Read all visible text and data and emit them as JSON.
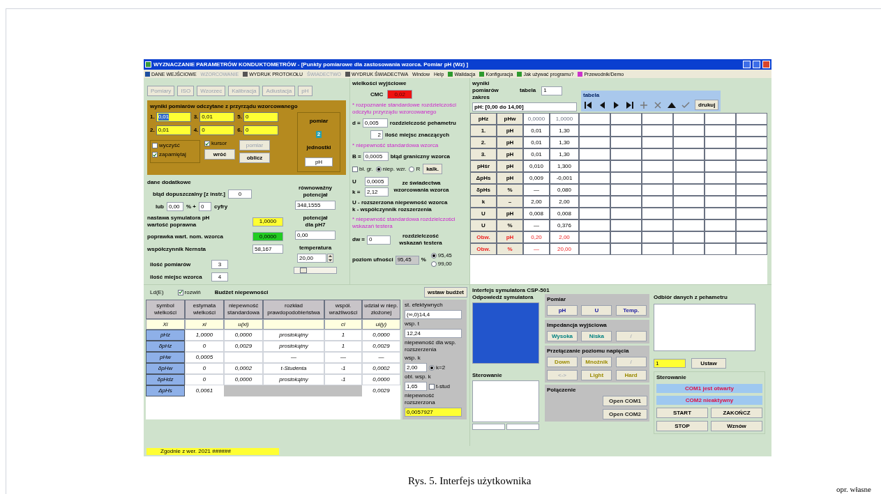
{
  "window": {
    "title": "WYZNACZANIE PARAMETRÓW KONDUKTOMETRÓW - [Punkty pomiarowe dla zastosowania wzorca. Pomiar pH (Wz) ]"
  },
  "menu": [
    {
      "label": "DANE WEJŚCIOWE",
      "disabled": false,
      "color": "#1f4fa0"
    },
    {
      "label": "WZORCOWANIE",
      "disabled": true
    },
    {
      "label": "WYDRUK PROTOKOŁU",
      "disabled": false,
      "color": "#555555"
    },
    {
      "label": "ŚWIADECTWO",
      "disabled": true
    },
    {
      "label": "WYDRUK ŚWIADECTWA",
      "disabled": false,
      "color": "#555555"
    },
    {
      "label": "Window",
      "disabled": false
    },
    {
      "label": "Help",
      "disabled": false
    },
    {
      "label": "Walidacja",
      "disabled": false,
      "color": "#2e9a2e"
    },
    {
      "label": "Konfiguracja",
      "disabled": false,
      "color": "#2e9a2e"
    },
    {
      "label": "Jak używać programu?",
      "disabled": false,
      "color": "#2e9a2e"
    },
    {
      "label": "Przewodnik/Demo",
      "disabled": false,
      "color": "#cc33cc"
    }
  ],
  "toolbar": [
    {
      "label": "Pomiary",
      "disabled": true
    },
    {
      "label": "ISO",
      "disabled": true
    },
    {
      "label": "Wzorzec",
      "disabled": true
    },
    {
      "label": "Kalibracja",
      "disabled": true
    },
    {
      "label": "Adiustacja",
      "disabled": true
    },
    {
      "label": "pH",
      "disabled": true
    }
  ],
  "readings": {
    "title": "wyniki pomiarów odczytane z przyrządu wzorcowanego",
    "fields": [
      {
        "index": "1.",
        "value": "0,01",
        "selected": true
      },
      {
        "index": "3.",
        "value": "0,01",
        "selected": false
      },
      {
        "index": "5.",
        "value": "0",
        "selected": false
      },
      {
        "index": "2.",
        "value": "0,01",
        "selected": false
      },
      {
        "index": "4.",
        "value": "0",
        "selected": false
      },
      {
        "index": "6.",
        "value": "0",
        "selected": false
      }
    ],
    "measure_label": "pomiar",
    "measure_value": "2",
    "unit_label": "jednostki",
    "unit": "pH",
    "checks": [
      {
        "label": "wyczyść",
        "checked": false
      },
      {
        "label": "zapamiętaj",
        "checked": true
      },
      {
        "label": "kursor",
        "checked": true
      }
    ],
    "buttons": [
      {
        "label": "pomiar",
        "disabled": true
      },
      {
        "label": "wróć",
        "disabled": false
      },
      {
        "label": "oblicz",
        "disabled": false
      }
    ]
  },
  "extra": {
    "title": "dane dodatkowe",
    "error_label": "błąd dopuszczalny [z instr.]",
    "error_value": "0",
    "or_label": "lub",
    "percent_value": "0,00",
    "percent_label": "% +",
    "digits_value": "0",
    "digits_label": "cyfry",
    "setpoint_label": "nastawa symulatora pH wartość poprawna",
    "setpoint_value": "1,0000",
    "correction_label": "poprawka wart. nom. wzorca",
    "correction_value": "0,0000",
    "nernst_label": "współczynnik Nernsta",
    "nernst_value": "58,167",
    "count_label": "ilość pomiarów",
    "count_value": "3",
    "places_label": "ilość miejsc wzorca",
    "places_value": "4",
    "potential_label": "równoważny potencjał",
    "potential_value": "348,1555",
    "ph7_label": "potencjał dla pH7",
    "ph7_value": "0,00",
    "temp_label": "temperatura",
    "temp_value": "20,00",
    "temp_slider": {
      "level": 0.15
    }
  },
  "outputs": {
    "title": "wielkości wyjściowe",
    "cmc_label": "CMC",
    "cmc_value": "0,02",
    "note1": "* rozpoznanie standardowe rozdzielczości odczytu przyrządu wzorcowanego",
    "d_label": "d =",
    "d_value": "0,005",
    "d_desc": "rozdzielczość pehametru",
    "digits_value": "2",
    "digits_desc": "ilość miejsc znaczących",
    "note2": "* niepewność standardowa wzorca",
    "b_label": "B =",
    "b_value": "0,0005",
    "b_desc": "błąd graniczny wzorca",
    "options": [
      {
        "kind": "checkbox",
        "label": "bł. gr.",
        "selected": false
      },
      {
        "kind": "radio",
        "label": "niep. wzr.",
        "selected": true
      },
      {
        "kind": "radio",
        "label": "R",
        "selected": false
      }
    ],
    "calc_button": "kalk.",
    "u_label": "U",
    "u_value": "0,0005",
    "k_label": "k =",
    "k_value": "2,12",
    "uk_desc": "ze świadectwa wzorcowania wzorca",
    "legend_u": "U - rozszerzona niepewność wzorca",
    "legend_k": "k - współczynnik rozszerzenia",
    "note3": "* niepewność standardowa rozdzielczości wskazań testera",
    "dw_label": "dw =",
    "dw_value": "0",
    "dw_desc": "rozdzielczość wskazań testera",
    "conf_label": "poziom ufności",
    "conf_value": "95,45",
    "conf_unit": "%",
    "conf_options": [
      {
        "label": "95,45",
        "selected": true
      },
      {
        "label": "99,00",
        "selected": false
      }
    ]
  },
  "results": {
    "range_label": "wyniki pomiarów zakres",
    "table_label": "tabela",
    "table_value": "1",
    "range_value": "pH: [0,00 do 14,00]",
    "nav_label": "tabela",
    "print_button": "drukuj",
    "columns": [
      "pHz",
      "pHw",
      "0,0000",
      "1,0000"
    ],
    "rows": [
      {
        "cells": [
          "1.",
          "pH",
          "0,01",
          "1,30"
        ],
        "alert": false
      },
      {
        "cells": [
          "2.",
          "pH",
          "0,01",
          "1,30"
        ],
        "alert": false
      },
      {
        "cells": [
          "3.",
          "pH",
          "0,01",
          "1,30"
        ],
        "alert": false
      },
      {
        "cells": [
          "pHśr",
          "pH",
          "0,010",
          "1,300"
        ],
        "alert": false
      },
      {
        "cells": [
          "ΔpHs",
          "pH",
          "0,009",
          "-0,001"
        ],
        "alert": false
      },
      {
        "cells": [
          "δpHs",
          "%",
          "—",
          "0,080"
        ],
        "alert": false
      },
      {
        "cells": [
          "k",
          "–",
          "2,00",
          "2,00"
        ],
        "alert": false
      },
      {
        "cells": [
          "U",
          "pH",
          "0,008",
          "0,008"
        ],
        "alert": false
      },
      {
        "cells": [
          "U",
          "%",
          "—",
          "0,376"
        ],
        "alert": false
      },
      {
        "cells": [
          "Obw.",
          "pH",
          "0,20",
          "2,00"
        ],
        "alert": true
      },
      {
        "cells": [
          "Obw.",
          "%",
          "—",
          "20,00"
        ],
        "alert": true
      }
    ]
  },
  "budget": {
    "ld_label": "Ld(E)",
    "expand": {
      "label": "rozwiń",
      "checked": true
    },
    "title": "Budżet niepewności",
    "insert_button": "wstaw budżet",
    "columns": [
      "symbol wielkości",
      "estymata wielkości",
      "niepewność standardowa",
      "rozkład prawdopodobieństwa",
      "współ. wrażliwości",
      "udział w niep. złożonej"
    ],
    "rows": [
      {
        "kind": "symbol",
        "cells": [
          "Xi",
          "xi",
          "u(xi)",
          "",
          "ci",
          "ui(y)"
        ]
      },
      {
        "kind": "value",
        "cells": [
          "pHz",
          "1,0000",
          "0,0000",
          "prostokątny",
          "1",
          "0,0000"
        ]
      },
      {
        "cells": [
          "δpHz",
          "0",
          "0,0029",
          "prostokątny",
          "1",
          "0,0029"
        ]
      },
      {
        "cells": [
          "pHw",
          "0,0005",
          "",
          "—",
          "—",
          "—"
        ]
      },
      {
        "cells": [
          "δpHw",
          "0",
          "0,0002",
          "t-Studenta",
          "-1",
          "0,0002"
        ]
      },
      {
        "cells": [
          "δpHdz",
          "0",
          "0,0000",
          "prostokątny",
          "-1",
          "0,0000"
        ]
      }
    ],
    "total": [
      "ΔpHs",
      "0,0061",
      "0,0029"
    ],
    "side": {
      "dof_label": "st. efektywnych",
      "dof_value": "(∞,0)14,4",
      "t_label": "wsp. t",
      "t_value": "12,24",
      "note": "niepewność dla wsp. rozszerzenia",
      "k_label": "wsp. k",
      "k_value": "2,00",
      "k_option": {
        "label": "k=2",
        "selected": true
      },
      "calc_k_label": "obl. wsp. k",
      "calc_k_value": "1,65",
      "tstud": {
        "label": "t-stud",
        "checked": false
      },
      "expanded_label": "niepewność rozszerzona",
      "expanded_value": "0,0057927"
    }
  },
  "status": "Zgodnie z wer. 2021 ######",
  "simulator": {
    "title": "Interfejs symulatora CSP-501",
    "response_label": "Odpowiedź symulatora",
    "control_label": "Sterowanie",
    "groups": [
      {
        "title": "Pomiar",
        "color": "#1a1aa0",
        "buttons": [
          {
            "label": "pH",
            "disabled": false
          },
          {
            "label": "U",
            "disabled": false
          },
          {
            "label": "Temp.",
            "disabled": false
          }
        ]
      },
      {
        "title": "Impedancja wyjściowa",
        "color": "#008080",
        "buttons": [
          {
            "label": "Wysoka",
            "disabled": false
          },
          {
            "label": "Niska",
            "disabled": false
          },
          {
            "label": "/",
            "disabled": true
          }
        ]
      },
      {
        "title": "Przełączanie poziomu napięcia",
        "color": "#9a8a00",
        "buttons": [
          {
            "label": "Down",
            "disabled": false
          },
          {
            "label": "Mnożnik",
            "disabled": false
          },
          {
            "label": "/",
            "disabled": true
          },
          {
            "label": "<->",
            "disabled": true
          },
          {
            "label": "Light",
            "disabled": false
          },
          {
            "label": "Hard",
            "disabled": false
          }
        ]
      },
      {
        "title": "Połączenie",
        "color": "#222222",
        "buttons": [
          {
            "label": "Open COM1",
            "disabled": false
          },
          {
            "label": "Open COM2",
            "disabled": false
          }
        ]
      }
    ],
    "receive_label": "Odbiór danych z pehametru",
    "set_value": "1",
    "set_button": "Ustaw",
    "control2_label": "Sterowanie",
    "com_status": [
      "COM1 jest otwarty",
      "COM2 nieaktywny"
    ],
    "actions": [
      "START",
      "ZAKOŃCZ",
      "STOP",
      "Wznów"
    ]
  },
  "caption": "Rys. 5. Interfejs użytkownika",
  "source": "opr. własne"
}
